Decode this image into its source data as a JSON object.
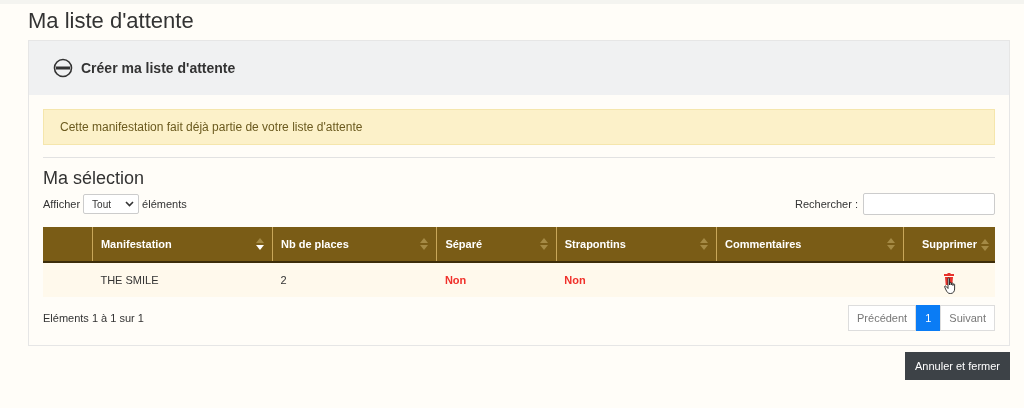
{
  "page_title": "Ma liste d'attente",
  "panel": {
    "title": "Créer ma liste d'attente",
    "expanded": true,
    "alert": "Cette manifestation fait déjà partie de votre liste d'attente",
    "section_title": "Ma sélection",
    "length_control": {
      "prefix": "Afficher",
      "value": "Tout",
      "suffix": "éléments"
    },
    "search": {
      "label": "Rechercher :"
    },
    "table": {
      "columns": [
        {
          "kind": "plain"
        },
        {
          "label": "Manifestation",
          "kind": "sorted"
        },
        {
          "label": "Nb de places",
          "kind": "sortable"
        },
        {
          "label": "Séparé",
          "kind": "sortable"
        },
        {
          "label": "Strapontins",
          "kind": "sortable"
        },
        {
          "label": "Commentaires",
          "kind": "sortable"
        },
        {
          "label": "Supprimer",
          "kind": "sortable"
        }
      ],
      "rows": [
        {
          "manifestation": "THE SMILE",
          "places": "2",
          "separe": "Non",
          "strapontins": "Non"
        }
      ]
    },
    "info": "Eléments 1 à 1 sur 1",
    "pagination": {
      "previous": {
        "label": "Précédent",
        "disabled": true
      },
      "pages": [
        {
          "label": "1",
          "selected": true
        }
      ],
      "next": {
        "label": "Suivant",
        "disabled": true
      }
    }
  },
  "close_button": "Annuler et fermer"
}
